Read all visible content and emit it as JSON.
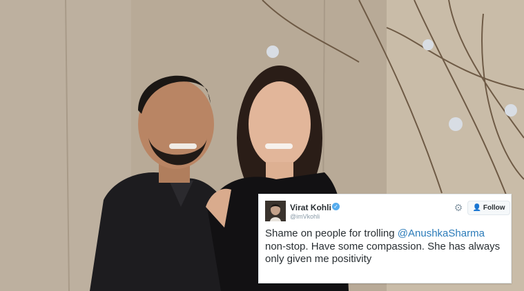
{
  "tweet": {
    "author_name": "Virat Kohli",
    "handle": "@imVkohli",
    "follow_label": "Follow",
    "text_before": "Shame on people for trolling ",
    "mention": "@AnushkaSharma",
    "text_after": " non-stop. Have some compassion. She has always only given me positivity"
  },
  "icons": {
    "verified": "verified-badge-icon",
    "settings": "gear-icon",
    "follow": "add-user-icon"
  },
  "colors": {
    "link": "#2b7bb9",
    "verified": "#55acee",
    "text": "#292f33",
    "secondary": "#8899a6"
  }
}
